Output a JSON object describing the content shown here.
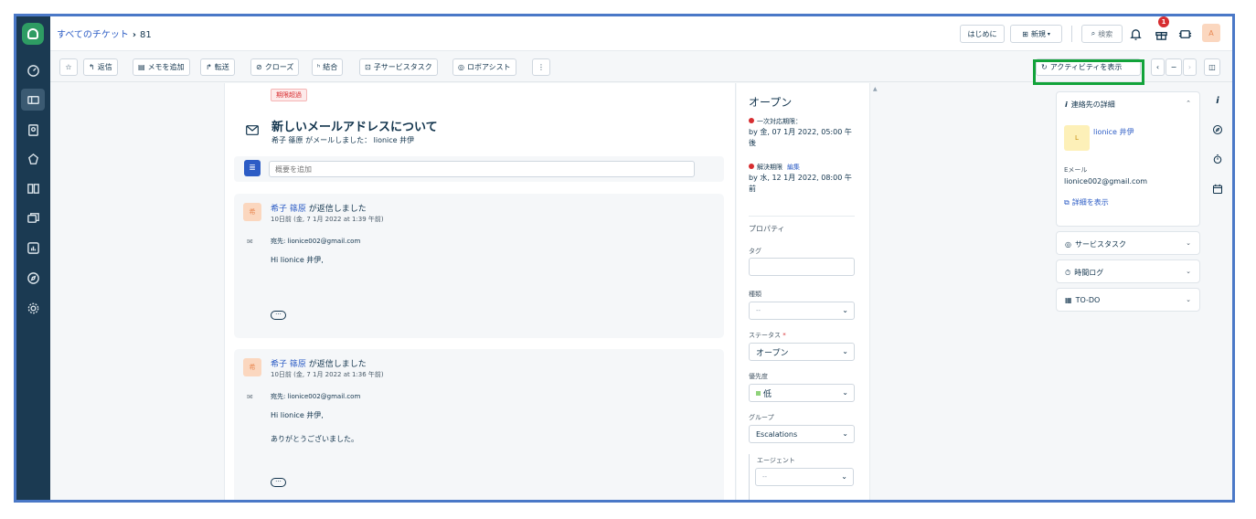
{
  "breadcrumb": {
    "all_tickets": "すべてのチケット",
    "separator": "›",
    "ticket_id": "81"
  },
  "topbar": {
    "getting_started": "はじめに",
    "new_button": "新規",
    "new_icon": "plus-box-icon",
    "search_label": "検索",
    "notification_count": "1",
    "avatar_initial": "A"
  },
  "toolbar": {
    "reply": "返信",
    "add_note": "メモを追加",
    "forward": "転送",
    "close": "クローズ",
    "merge": "結合",
    "child_task": "子サービスタスク",
    "robo_assist": "ロボアシスト",
    "more": "⋮",
    "show_activity": "アクティビティを表示",
    "nav_prev": "‹",
    "nav_minus": "−",
    "nav_next": "›"
  },
  "ticket": {
    "overdue_badge": "期限超過",
    "subject": "新しいメールアドレスについて",
    "subline": "希子 篠原 がメールしました： lionice 井伊",
    "summary_placeholder": "概要を追加"
  },
  "messages": [
    {
      "avatar": "希",
      "name": "希子 篠原",
      "action": " が返信しました",
      "time": "10日前 (金, 7 1月 2022 at 1:39 午前)",
      "to": "宛先: lionice002@gmail.com",
      "body_lines": [
        "Hi lionice 井伊,"
      ],
      "more": "···"
    },
    {
      "avatar": "希",
      "name": "希子 篠原",
      "action": " が返信しました",
      "time": "10日前 (金, 7 1月 2022 at 1:36 午前)",
      "to": "宛先: lionice002@gmail.com",
      "body_lines": [
        "Hi lionice 井伊,",
        "ありがとうございました。"
      ],
      "more": "···"
    }
  ],
  "properties": {
    "status_title": "オープン",
    "first_response_label": "一次対応期限：",
    "first_response_due": "by 金, 07 1月 2022, 05:00 午後",
    "resolution_label": "解決期限",
    "resolution_edit": "編集",
    "resolution_due": "by 水, 12 1月 2022, 08:00 午前",
    "section_title": "プロパティ",
    "tags_label": "タグ",
    "type_label": "種類",
    "type_value": "--",
    "status_label": "ステータス",
    "required_mark": "*",
    "status_value": "オープン",
    "priority_label": "優先度",
    "priority_value": "低",
    "priority_color": "#8fd27a",
    "group_label": "グループ",
    "group_value": "Escalations",
    "agent_label": "エージェント",
    "agent_value": "--"
  },
  "contact_panel": {
    "title": "連絡先の詳細",
    "avatar": "L",
    "name": "lionice 井伊",
    "email_label": "Eメール",
    "email": "lionice002@gmail.com",
    "details_link": "詳細を表示"
  },
  "side_cards": {
    "service_task": "サービスタスク",
    "time_log": "時間ログ",
    "todo": "TO-DO"
  },
  "colors": {
    "nav_bg": "#1b3a52",
    "accent": "#2c5cc5",
    "logo": "#2e9c63",
    "highlight": "#12a33a",
    "alert": "#d72d30"
  }
}
